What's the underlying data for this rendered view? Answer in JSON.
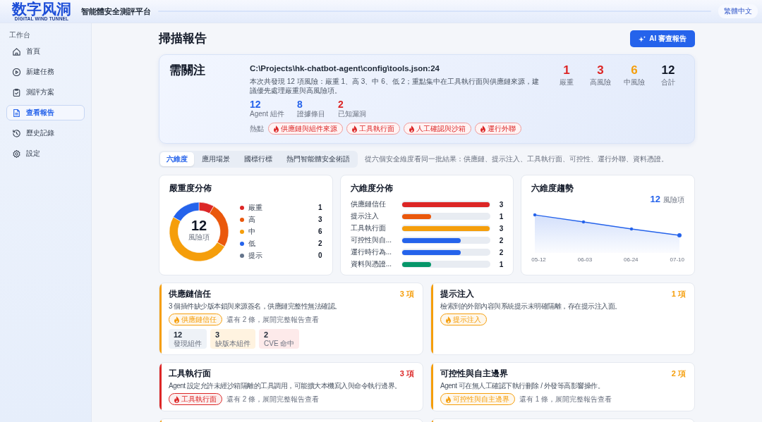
{
  "header": {
    "logo": {
      "title": "数字风洞",
      "subtitle": "DIGITAL WIND TUNNEL"
    },
    "platform": "智能體安全測評平台",
    "language": "繁體中文"
  },
  "sidebar": {
    "section": "工作台",
    "items": [
      {
        "label": "首頁",
        "selected": false
      },
      {
        "label": "新建任務",
        "selected": false
      },
      {
        "label": "測評方案",
        "selected": false
      },
      {
        "label": "查看報告",
        "selected": true
      },
      {
        "label": "歷史記錄",
        "selected": false
      },
      {
        "label": "設定",
        "selected": false
      }
    ]
  },
  "page": {
    "title": "掃描報告",
    "action": "AI 審查報告"
  },
  "summary": {
    "status": "需關注",
    "path": "C:\\Projects\\hk-chatbot-agent\\config\\tools.json:24",
    "description": "本次共發現 12 項風險：嚴重 1、高 3、中 6、低 2；重點集中在工具執行面與供應鏈來源，建議優先處理嚴重與高風險項。",
    "metrics": [
      {
        "value": "12",
        "label": "Agent 組件",
        "color": "#2563eb"
      },
      {
        "value": "8",
        "label": "證據條目",
        "color": "#2563eb"
      },
      {
        "value": "2",
        "label": "已知漏洞",
        "color": "#dc2626"
      }
    ],
    "hotspots_label": "熱點",
    "hotspots": [
      "供應鏈與組件來源",
      "工具執行面",
      "人工確認與沙箱",
      "運行外聯"
    ],
    "stats": [
      {
        "value": "1",
        "label": "嚴重",
        "color": "#dc2626"
      },
      {
        "value": "3",
        "label": "高風險",
        "color": "#dc2626"
      },
      {
        "value": "6",
        "label": "中風險",
        "color": "#f59e0b"
      },
      {
        "value": "12",
        "label": "合計",
        "color": "#111827"
      }
    ]
  },
  "tabs": [
    {
      "label": "六維度",
      "selected": true
    },
    {
      "label": "應用場景",
      "selected": false
    },
    {
      "label": "國標行標",
      "selected": false
    },
    {
      "label": "熱門智能體安全術語",
      "selected": false
    }
  ],
  "tabs_note": "從六個安全維度看同一批結果：供應鏈、提示注入、工具執行面、可控性、運行外聯、資料憑證。",
  "severity_chart": {
    "title": "嚴重度分佈",
    "total": "12",
    "total_label": "風險項",
    "legend_entries": [
      {
        "count": "1",
        "color": "#dc2626"
      },
      {
        "count": "3",
        "color": "#ea580c"
      },
      {
        "count": "6",
        "color": "#f59e0b"
      },
      {
        "count": "2",
        "color": "#2563eb"
      },
      {
        "count": "0",
        "color": "#64748b"
      }
    ],
    "chart_data": {
      "type": "donut",
      "categories": [
        "嚴重",
        "高",
        "中",
        "低",
        "提示"
      ],
      "values": [
        8.33,
        25,
        50,
        16.67,
        0
      ],
      "legend": "right"
    }
  },
  "dimension_chart": {
    "title": "六維度分佈",
    "rows": [
      {
        "label": "供應鏈信任",
        "count": "3",
        "level": 1,
        "color": "#dc2626"
      },
      {
        "label": "提示注入",
        "count": "1",
        "level": 0.333,
        "color": "#ea580c"
      },
      {
        "label": "工具執行面",
        "count": "3",
        "level": 1,
        "color": "#f59e0b"
      },
      {
        "label": "可控性與自...",
        "count": "2",
        "level": 0.667,
        "color": "#2563eb"
      },
      {
        "label": "運行時行為...",
        "count": "2",
        "level": 0.667,
        "color": "#2563eb"
      },
      {
        "label": "資料與憑證...",
        "count": "1",
        "level": 0.333,
        "color": "#059669"
      }
    ]
  },
  "trend_chart": {
    "title": "六維度趨勢",
    "total": "12",
    "total_label": "風險項",
    "x_labels": [
      "05-12",
      "06-03",
      "06-24",
      "07-10"
    ]
  },
  "findings": [
    {
      "title": "供應鏈信任",
      "count": "3 項",
      "color": "#f59e0b",
      "description": "3 個插件缺少版本鎖與來源簽名，供應鏈完整性無法確認。",
      "tag": "供應鏈信任",
      "more": "還有 2 條，展開完整報告查看",
      "stats": [
        {
          "value": "12",
          "label": "發現組件",
          "color": "#eef2f7"
        },
        {
          "value": "3",
          "label": "缺版本組件",
          "color": "#fff3e0"
        },
        {
          "value": "2",
          "label": "CVE 命中",
          "color": "#fdeaea"
        }
      ]
    },
    {
      "title": "提示注入",
      "count": "1 項",
      "color": "#f59e0b",
      "description": "檢索到的外部內容與系統提示未明確隔離，存在提示注入面。",
      "tag": "提示注入"
    },
    {
      "title": "工具執行面",
      "count": "3 項",
      "color": "#dc2626",
      "description": "Agent 設定允許未經沙箱隔離的工具調用，可能擴大本機寫入與命令執行邊界。",
      "tag": "工具執行面",
      "more": "還有 2 條，展開完整報告查看"
    },
    {
      "title": "可控性與自主邊界",
      "count": "2 項",
      "color": "#f59e0b",
      "description": "Agent 可在無人工確認下執行刪除 / 外發等高影響操作。",
      "tag": "可控性與自主邊界",
      "more": "還有 1 條，展開完整報告查看"
    },
    {
      "color": "#f59e0b"
    },
    {
      "color": "#f59e0b"
    }
  ]
}
